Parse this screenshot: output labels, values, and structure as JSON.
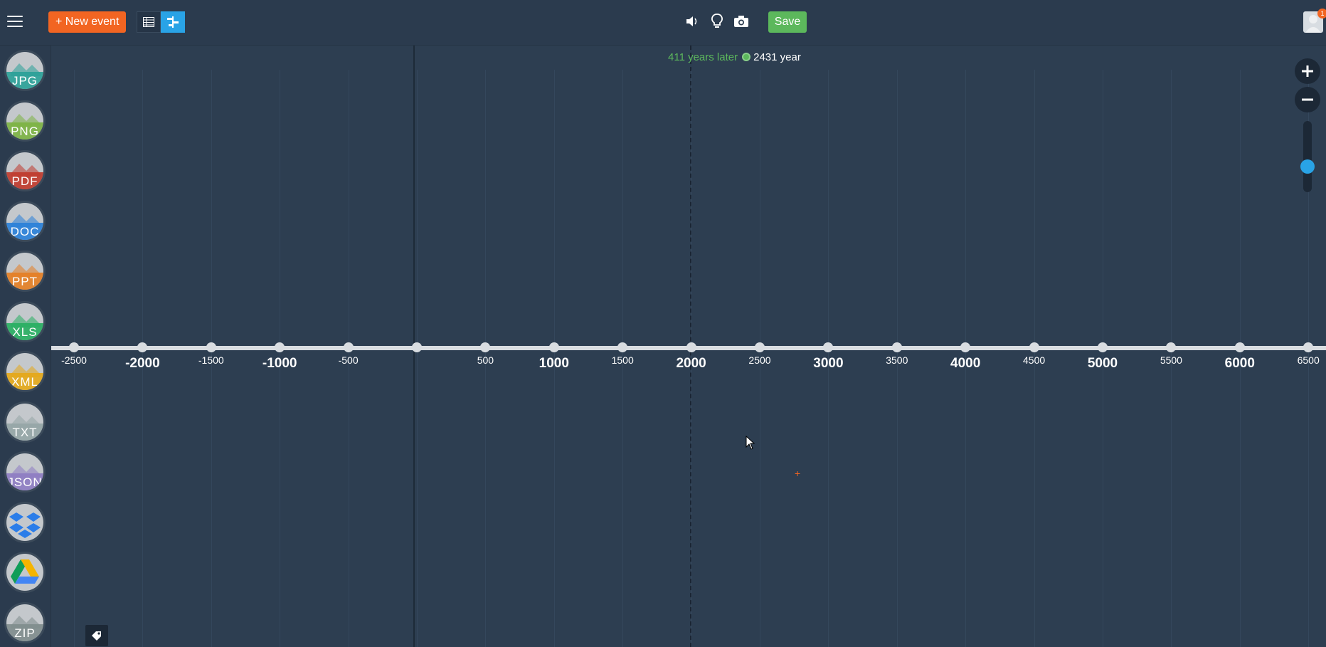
{
  "header": {
    "new_event_label": "+ New event",
    "save_label": "Save",
    "notification_count": "1"
  },
  "sidebar": {
    "items": [
      {
        "label": "JPG",
        "icon": "jpg-file-icon",
        "color": "#2aa198"
      },
      {
        "label": "PNG",
        "icon": "png-file-icon",
        "color": "#7cb342"
      },
      {
        "label": "PDF",
        "icon": "pdf-file-icon",
        "color": "#c0392b"
      },
      {
        "label": "DOC",
        "icon": "doc-file-icon",
        "color": "#2980d9"
      },
      {
        "label": "PPT",
        "icon": "ppt-file-icon",
        "color": "#e67e22"
      },
      {
        "label": "XLS",
        "icon": "xls-file-icon",
        "color": "#27ae60"
      },
      {
        "label": "XML",
        "icon": "xml-file-icon",
        "color": "#e6a817"
      },
      {
        "label": "TXT",
        "icon": "txt-file-icon",
        "color": "#95a5a6"
      },
      {
        "label": "JSON",
        "icon": "json-file-icon",
        "color": "#8e7cc3"
      },
      {
        "label": "",
        "icon": "dropbox-icon",
        "color": "#2b7de9"
      },
      {
        "label": "",
        "icon": "google-drive-icon",
        "color": "#f4b400"
      },
      {
        "label": "ZIP",
        "icon": "zip-file-icon",
        "color": "#7f8c8d"
      }
    ]
  },
  "timeline": {
    "now_later": "411 years later",
    "now_year": "2431 year",
    "ticks": [
      {
        "label": "-2500",
        "major": false
      },
      {
        "label": "-2000",
        "major": true
      },
      {
        "label": "-1500",
        "major": false
      },
      {
        "label": "-1000",
        "major": true
      },
      {
        "label": "-500",
        "major": false
      },
      {
        "label": "",
        "major": false
      },
      {
        "label": "500",
        "major": false
      },
      {
        "label": "1000",
        "major": true
      },
      {
        "label": "1500",
        "major": false
      },
      {
        "label": "2000",
        "major": true
      },
      {
        "label": "2500",
        "major": false
      },
      {
        "label": "3000",
        "major": true
      },
      {
        "label": "3500",
        "major": false
      },
      {
        "label": "4000",
        "major": true
      },
      {
        "label": "4500",
        "major": false
      },
      {
        "label": "5000",
        "major": true
      },
      {
        "label": "5500",
        "major": false
      },
      {
        "label": "6000",
        "major": true
      },
      {
        "label": "6500",
        "major": false
      }
    ]
  },
  "zoom": {
    "level": 0.4
  },
  "colors": {
    "accent": "#f26522",
    "save": "#5cb85c",
    "active": "#29a3e6",
    "background": "#2d3e51"
  }
}
